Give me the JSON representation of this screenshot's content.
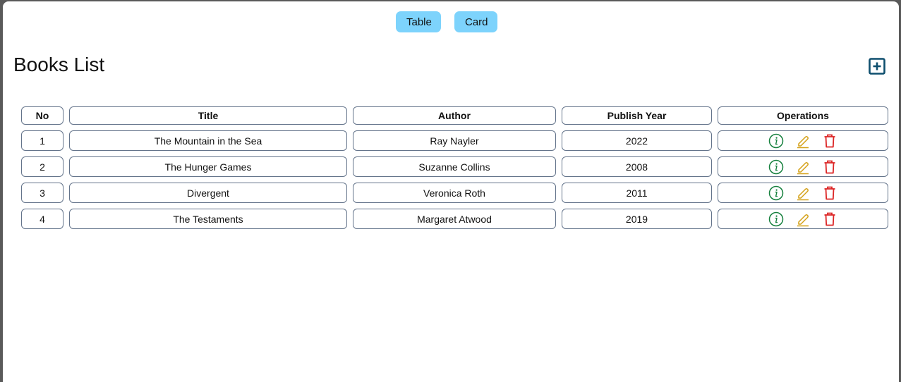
{
  "toggle": {
    "table_label": "Table",
    "card_label": "Card"
  },
  "page": {
    "title": "Books List",
    "add_icon": "plus-square-icon"
  },
  "table": {
    "headers": [
      "No",
      "Title",
      "Author",
      "Publish Year",
      "Operations"
    ],
    "rows": [
      {
        "no": "1",
        "title": "The Mountain in the Sea",
        "author": "Ray Nayler",
        "year": "2022"
      },
      {
        "no": "2",
        "title": "The Hunger Games",
        "author": "Suzanne Collins",
        "year": "2008"
      },
      {
        "no": "3",
        "title": "Divergent",
        "author": "Veronica Roth",
        "year": "2011"
      },
      {
        "no": "4",
        "title": "The Testaments",
        "author": "Margaret Atwood",
        "year": "2019"
      }
    ],
    "operation_icons": [
      "info-circle-icon",
      "edit-pencil-icon",
      "delete-trash-icon"
    ]
  },
  "colors": {
    "toggle_bg": "#7dd3fc",
    "add_icon": "#0e4f6e",
    "info_icon": "#15803d",
    "edit_icon": "#d4a017",
    "delete_icon": "#dc2626",
    "cell_border": "#64748b"
  }
}
